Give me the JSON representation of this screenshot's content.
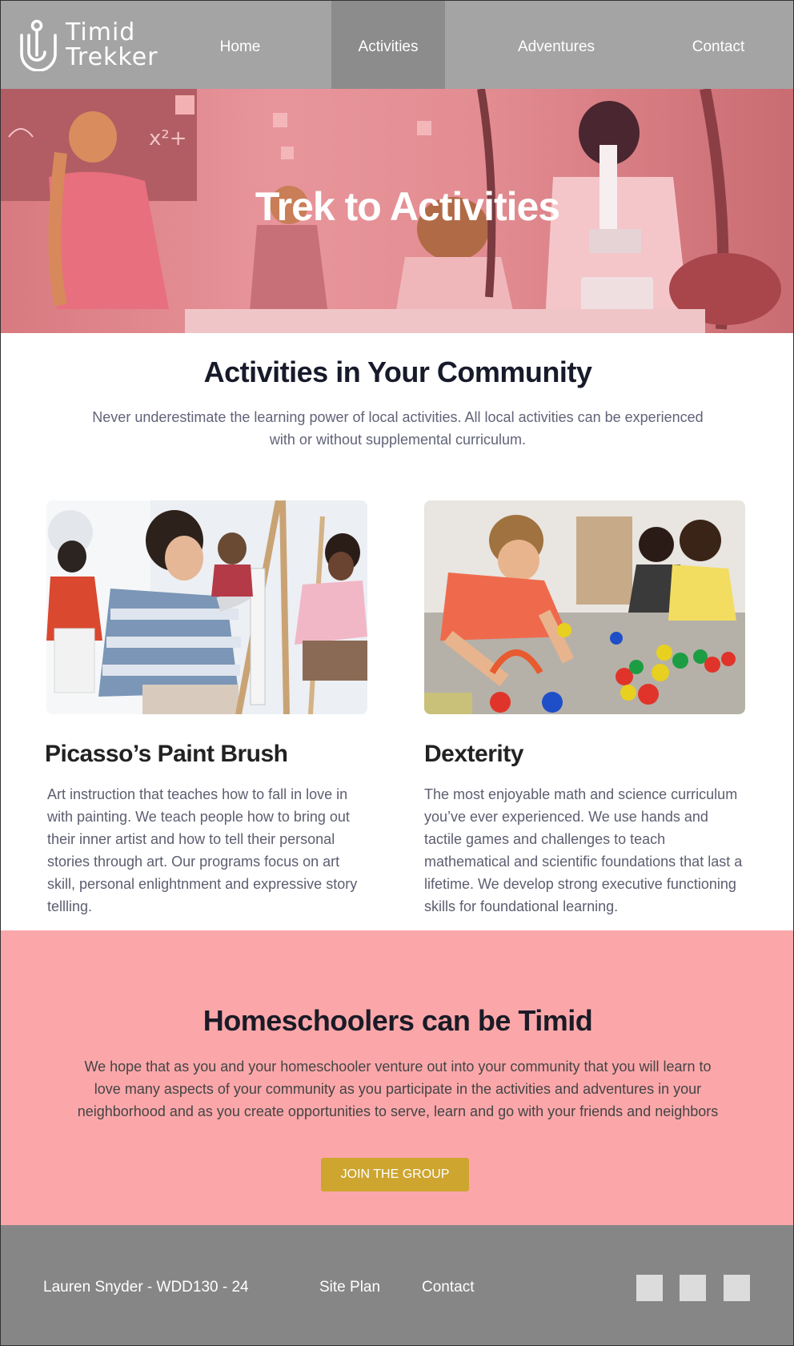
{
  "nav": {
    "logo": {
      "line1": "Timid",
      "line2": "Trekker",
      "icon": "u-shaped-trekker-logo-icon"
    },
    "items": [
      {
        "label": "Home",
        "active": false
      },
      {
        "label": "Activities",
        "active": true
      },
      {
        "label": "Adventures",
        "active": false
      },
      {
        "label": "Contact",
        "active": false
      }
    ]
  },
  "hero": {
    "title": "Trek to Activities",
    "image": "children-science-classroom-photo",
    "overlay_color": "#e8868c"
  },
  "intro": {
    "title": "Activities in Your Community",
    "text": "Never underestimate the learning power of local activities. All local activities can be experienced with or without supplemental curriculum."
  },
  "cards": [
    {
      "image": "students-painting-at-easels-photo",
      "title": "Picasso’s Paint Brush",
      "text": "Art instruction that teaches how to fall in love in with painting. We teach people how to bring out their inner artist and how to tell their personal stories through art. Our programs focus on art skill, personal enlightnment and expressive story tellling."
    },
    {
      "image": "children-playing-with-colorful-toys-photo",
      "title": "Dexterity",
      "text": "The most enjoyable math and science curriculum you’ve ever experienced. We use hands and tactile games and challenges to teach mathematical and scientific foundations that last a lifetime. We develop strong executive functioning skills for foundational learning."
    }
  ],
  "cta": {
    "title": "Homeschoolers can be Timid",
    "text": "We hope that as you and your homeschooler venture out into your community that you will learn to love many aspects of your community as you participate in the activities and adventures in your neighborhood and as you create opportunities to serve, learn and go with your friends and neighbors",
    "button": "JOIN THE GROUP"
  },
  "footer": {
    "credit": "Lauren Snyder - WDD130 - 24",
    "links": [
      "Site Plan",
      "Contact"
    ],
    "social_icons": [
      "social-icon-1",
      "social-icon-2",
      "social-icon-3"
    ]
  },
  "colors": {
    "nav_bg": "#a4a4a4",
    "nav_active": "#8c8c8c",
    "cta_bg": "#fba7aa",
    "button": "#cda52f",
    "footer_bg": "#868686"
  }
}
